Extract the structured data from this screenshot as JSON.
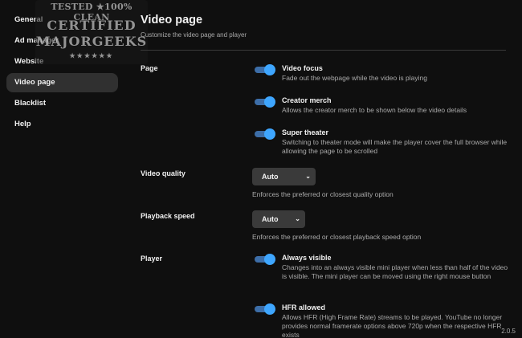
{
  "sidebar": {
    "items": [
      {
        "label": "General",
        "active": false
      },
      {
        "label": "Ad manager",
        "active": false
      },
      {
        "label": "Website",
        "active": false
      },
      {
        "label": "Video page",
        "active": true
      },
      {
        "label": "Blacklist",
        "active": false
      },
      {
        "label": "Help",
        "active": false
      }
    ]
  },
  "watermark": {
    "line1": "TESTED ★100% CLEAN",
    "line2": "CERTIFIED",
    "line3": "MAJORGEEKS",
    "line4": "★★★★★★"
  },
  "header": {
    "title": "Video page",
    "subtitle": "Customize the video page and player"
  },
  "sections": {
    "page": {
      "label": "Page",
      "settings": [
        {
          "title": "Video focus",
          "description": "Fade out the webpage while the video is playing",
          "enabled": true
        },
        {
          "title": "Creator merch",
          "description": "Allows the creator merch to be shown below the video details",
          "enabled": true
        },
        {
          "title": "Super theater",
          "description": "Switching to theater mode will make the player cover the full browser while allowing the page to be scrolled",
          "enabled": true
        }
      ]
    },
    "video_quality": {
      "label": "Video quality",
      "value": "Auto",
      "description": "Enforces the preferred or closest quality option"
    },
    "playback_speed": {
      "label": "Playback speed",
      "value": "Auto",
      "description": "Enforces the preferred or closest playback speed option"
    },
    "player": {
      "label": "Player",
      "settings": [
        {
          "title": "Always visible",
          "description": "Changes into an always visible mini player when less than half of the video is visible. The mini player can be moved using the right mouse button",
          "enabled": true
        },
        {
          "title": "HFR allowed",
          "description": "Allows HFR (High Frame Rate) streams to be played. YouTube no longer provides normal framerate options above 720p when the respective HFR exists",
          "enabled": true
        }
      ]
    }
  },
  "version": "2.0.5",
  "colors": {
    "background": "#0f0f0f",
    "accent": "#3ea6ff",
    "active_item": "#303030",
    "secondary_text": "#aaaaaa"
  }
}
